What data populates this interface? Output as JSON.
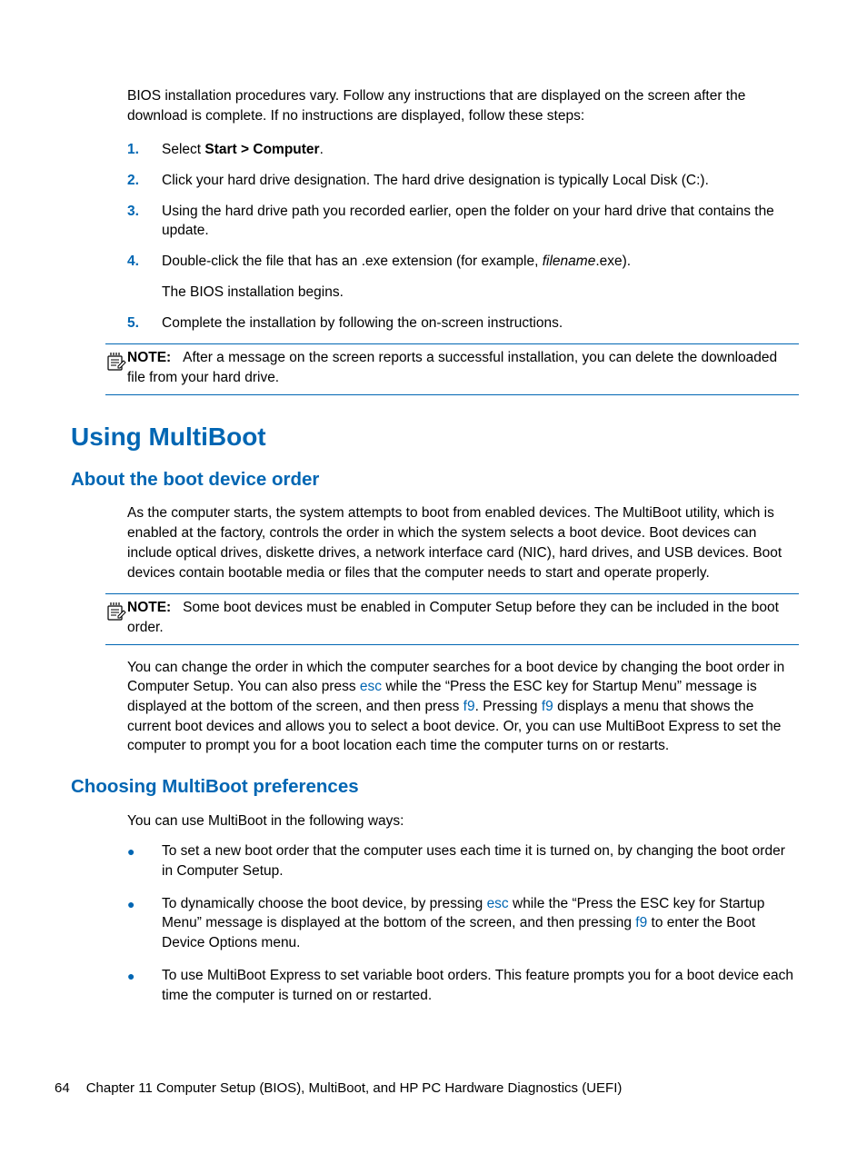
{
  "intro": "BIOS installation procedures vary. Follow any instructions that are displayed on the screen after the download is complete. If no instructions are displayed, follow these steps:",
  "steps": [
    {
      "num": "1.",
      "pre": "Select ",
      "bold": "Start > Computer",
      "post": "."
    },
    {
      "num": "2.",
      "text": "Click your hard drive designation. The hard drive designation is typically Local Disk (C:)."
    },
    {
      "num": "3.",
      "text": "Using the hard drive path you recorded earlier, open the folder on your hard drive that contains the update."
    },
    {
      "num": "4.",
      "pre": "Double-click the file that has an .exe extension (for example, ",
      "italic": "filename",
      "post": ".exe).",
      "followup": "The BIOS installation begins."
    },
    {
      "num": "5.",
      "text": "Complete the installation by following the on-screen instructions."
    }
  ],
  "note1": {
    "label": "NOTE:",
    "text": "After a message on the screen reports a successful installation, you can delete the downloaded file from your hard drive."
  },
  "h1": "Using MultiBoot",
  "h2a": "About the boot device order",
  "about_para": "As the computer starts, the system attempts to boot from enabled devices. The MultiBoot utility, which is enabled at the factory, controls the order in which the system selects a boot device. Boot devices can include optical drives, diskette drives, a network interface card (NIC), hard drives, and USB devices. Boot devices contain bootable media or files that the computer needs to start and operate properly.",
  "note2": {
    "label": "NOTE:",
    "text": "Some boot devices must be enabled in Computer Setup before they can be included in the boot order."
  },
  "change": {
    "p1": "You can change the order in which the computer searches for a boot device by changing the boot order in Computer Setup. You can also press ",
    "k1": "esc",
    "p2": " while the “Press the ESC key for Startup Menu” message is displayed at the bottom of the screen, and then press ",
    "k2": "f9",
    "p3": ". Pressing ",
    "k3": "f9",
    "p4": " displays a menu that shows the current boot devices and allows you to select a boot device. Or, you can use MultiBoot Express to set the computer to prompt you for a boot location each time the computer turns on or restarts."
  },
  "h2b": "Choosing MultiBoot preferences",
  "pref_intro": "You can use MultiBoot in the following ways:",
  "bullets": [
    {
      "text": "To set a new boot order that the computer uses each time it is turned on, by changing the boot order in Computer Setup."
    },
    {
      "p1": "To dynamically choose the boot device, by pressing ",
      "k1": "esc",
      "p2": " while the “Press the ESC key for Startup Menu” message is displayed at the bottom of the screen, and then pressing ",
      "k2": "f9",
      "p3": " to enter the Boot Device Options menu."
    },
    {
      "text": "To use MultiBoot Express to set variable boot orders. This feature prompts you for a boot device each time the computer is turned on or restarted."
    }
  ],
  "footer": {
    "page": "64",
    "chapter": "Chapter 11   Computer Setup (BIOS), MultiBoot, and HP PC Hardware Diagnostics (UEFI)"
  }
}
